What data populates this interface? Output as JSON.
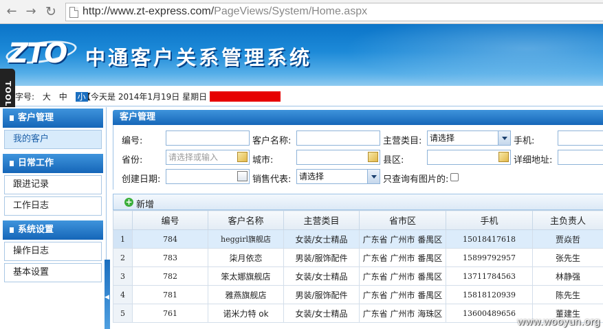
{
  "browser": {
    "url_host": "http://www.zt-express.com/",
    "url_path": "PageViews/System/Home.aspx",
    "back_icon": "back-arrow-icon",
    "forward_icon": "forward-arrow-icon",
    "reload_icon": "reload-icon"
  },
  "header": {
    "logo_text": "ZTO",
    "title": "中通客户关系管理系统"
  },
  "infobar": {
    "font_size_label": "字号:",
    "sizes": [
      "大",
      "中",
      "小"
    ],
    "selected_size": "小",
    "today_text": "【今天是 2014年1月19日 星期日 】"
  },
  "tools": {
    "label": "TOOLS"
  },
  "sidebar": {
    "sections": [
      {
        "title": "客户管理",
        "items": [
          {
            "label": "我的客户",
            "active": true
          }
        ]
      },
      {
        "title": "日常工作",
        "items": [
          {
            "label": "跟进记录"
          },
          {
            "label": "工作日志"
          }
        ]
      },
      {
        "title": "系统设置",
        "items": [
          {
            "label": "操作日志"
          },
          {
            "label": "基本设置"
          }
        ]
      }
    ]
  },
  "main": {
    "title": "客户管理",
    "form": {
      "code_label": "编号:",
      "code_value": "",
      "name_label": "客户名称:",
      "name_value": "",
      "category_label": "主营类目:",
      "category_value": "请选择",
      "phone_label": "手机:",
      "province_label": "省份:",
      "province_placeholder": "请选择或输入",
      "city_label": "城市:",
      "county_label": "县区:",
      "address_label": "详细地址:",
      "created_label": "创建日期:",
      "sales_label": "销售代表:",
      "sales_value": "请选择",
      "only_images_label": "只查询有图片的:"
    },
    "toolbar": {
      "add_label": "新增"
    },
    "table": {
      "columns": [
        "编号",
        "客户名称",
        "主营类目",
        "省市区",
        "手机",
        "主负责人"
      ],
      "rows": [
        {
          "n": "1",
          "code": "784",
          "name": "heggirl旗舰店",
          "category": "女装/女士精品",
          "region": "广东省 广州市 番禺区",
          "phone": "15018417618",
          "owner": "贾焱哲"
        },
        {
          "n": "2",
          "code": "783",
          "name": "柒月依恋",
          "category": "男装/服饰配件",
          "region": "广东省 广州市 番禺区",
          "phone": "15899792957",
          "owner": "张先生"
        },
        {
          "n": "3",
          "code": "782",
          "name": "笨太娜旗舰店",
          "category": "女装/女士精品",
          "region": "广东省 广州市 番禺区",
          "phone": "13711784563",
          "owner": "林静强"
        },
        {
          "n": "4",
          "code": "781",
          "name": "雅燕旗舰店",
          "category": "男装/服饰配件",
          "region": "广东省 广州市 番禺区",
          "phone": "15818120939",
          "owner": "陈先生"
        },
        {
          "n": "5",
          "code": "761",
          "name": "诺米力特 ok",
          "category": "女装/女士精品",
          "region": "广东省 广州市 海珠区",
          "phone": "13600489656",
          "owner": "董建生"
        }
      ]
    }
  },
  "watermark": "www.wooyun.org",
  "colors": {
    "header_blue": "#1566b8",
    "selected_row": "#dcecfb",
    "redaction": "#e60000"
  }
}
